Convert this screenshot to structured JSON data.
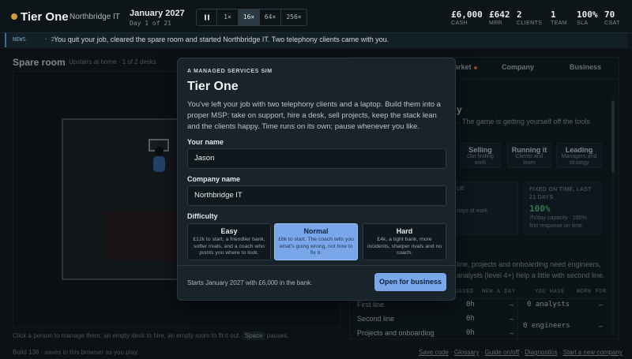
{
  "topbar": {
    "brand": "Tier One",
    "company": "Northbridge IT",
    "date": "January 2027",
    "day": "Day 1 of 21",
    "speeds": [
      "1×",
      "16×",
      "64×",
      "256×"
    ],
    "active_speed": "16×",
    "stats": [
      {
        "value": "£6,000",
        "label": "CASH"
      },
      {
        "value": "£642",
        "label": "MRR"
      },
      {
        "value": "2",
        "label": "CLIENTS"
      },
      {
        "value": "1",
        "label": "TEAM"
      },
      {
        "value": "100%",
        "label": "SLA"
      },
      {
        "value": "70",
        "label": "CSAT"
      }
    ]
  },
  "news": {
    "tag": "NEWS",
    "count": "· 2",
    "text": "You quit your job, cleared the spare room and started Northbridge IT. Two telephony clients came with you."
  },
  "room": {
    "title": "Spare room",
    "subtitle": "Upstairs at home · 1 of 2 desks",
    "hint_before": "Click a person to manage them, an empty desk to hire, an empty room to fit it out.",
    "hint_key": "Space",
    "hint_after": "pauses."
  },
  "right_panel": {
    "tabs": [
      "arket",
      "Company",
      "Business"
    ],
    "heading_fragment": "y",
    "goal_fragment": ". The game is getting yourself off the tools",
    "minis": [
      {
        "title": "Selling",
        "sub1": "Out finding",
        "sub2": "work"
      },
      {
        "title": "Running it",
        "sub1": "Clients and",
        "sub2": "team"
      },
      {
        "title": "Leading",
        "sub1": "Managers and",
        "sub2": "strategy"
      }
    ],
    "card1_head": "UE",
    "card1_sub": "days of work",
    "fixed_head_1": "FIXED ON TIME, LAST",
    "fixed_head_2": "21 DAYS",
    "fixed_value": "100%",
    "fixed_sub_1": "7h/day capacity · 100%",
    "fixed_sub_2": "first response on time",
    "note1": "line, projects and onboarding need engineers,",
    "note2": "analysts (level 4+) help a little with second line.",
    "table": {
      "headers": [
        "UEUED",
        "NEW A DAY",
        "YOU HAVE",
        "WORK FOR"
      ],
      "rows": [
        {
          "name": "First line",
          "queued": "0h",
          "new": "–"
        },
        {
          "name": "Second line",
          "queued": "0h",
          "new": "–"
        },
        {
          "name": "Projects and onboarding",
          "queued": "0h",
          "new": "–"
        }
      ],
      "have": [
        {
          "label": "0 analysts",
          "work": "–"
        },
        {
          "label": "0 engineers",
          "work": "–"
        }
      ]
    }
  },
  "footer": {
    "build": "Build 138 · saves in this browser as you play.",
    "links": [
      "Save code",
      "Glossary",
      "Guide on/off",
      "Diagnostics",
      "Start a new company"
    ]
  },
  "modal": {
    "kicker": "A MANAGED SERVICES SIM",
    "title": "Tier One",
    "description": "You've left your job with two telephony clients and a laptop. Build them into a proper MSP: take on support, hire a desk, sell projects, keep the stack lean and the clients happy. Time runs on its own; pause whenever you like.",
    "name_label": "Your name",
    "name_value": "Jason",
    "company_label": "Company name",
    "company_value": "Northbridge IT",
    "difficulty_label": "Difficulty",
    "difficulties": [
      {
        "title": "Easy",
        "desc": "£12k to start, a friendlier bank, softer rivals, and a coach who points you where to look."
      },
      {
        "title": "Normal",
        "desc": "£6k to start. The coach tells you what's going wrong, not how to fix it."
      },
      {
        "title": "Hard",
        "desc": "£4k, a tight bank, more incidents, sharper rivals and no coach."
      }
    ],
    "selected_difficulty": "Normal",
    "footer_text": "Starts January 2027 with £6,000 in the bank.",
    "start_button": "Open for business"
  },
  "colors": {
    "accent": "#7aa6ea",
    "good": "#5fc48a",
    "brand_dot": "#d29a3a"
  }
}
